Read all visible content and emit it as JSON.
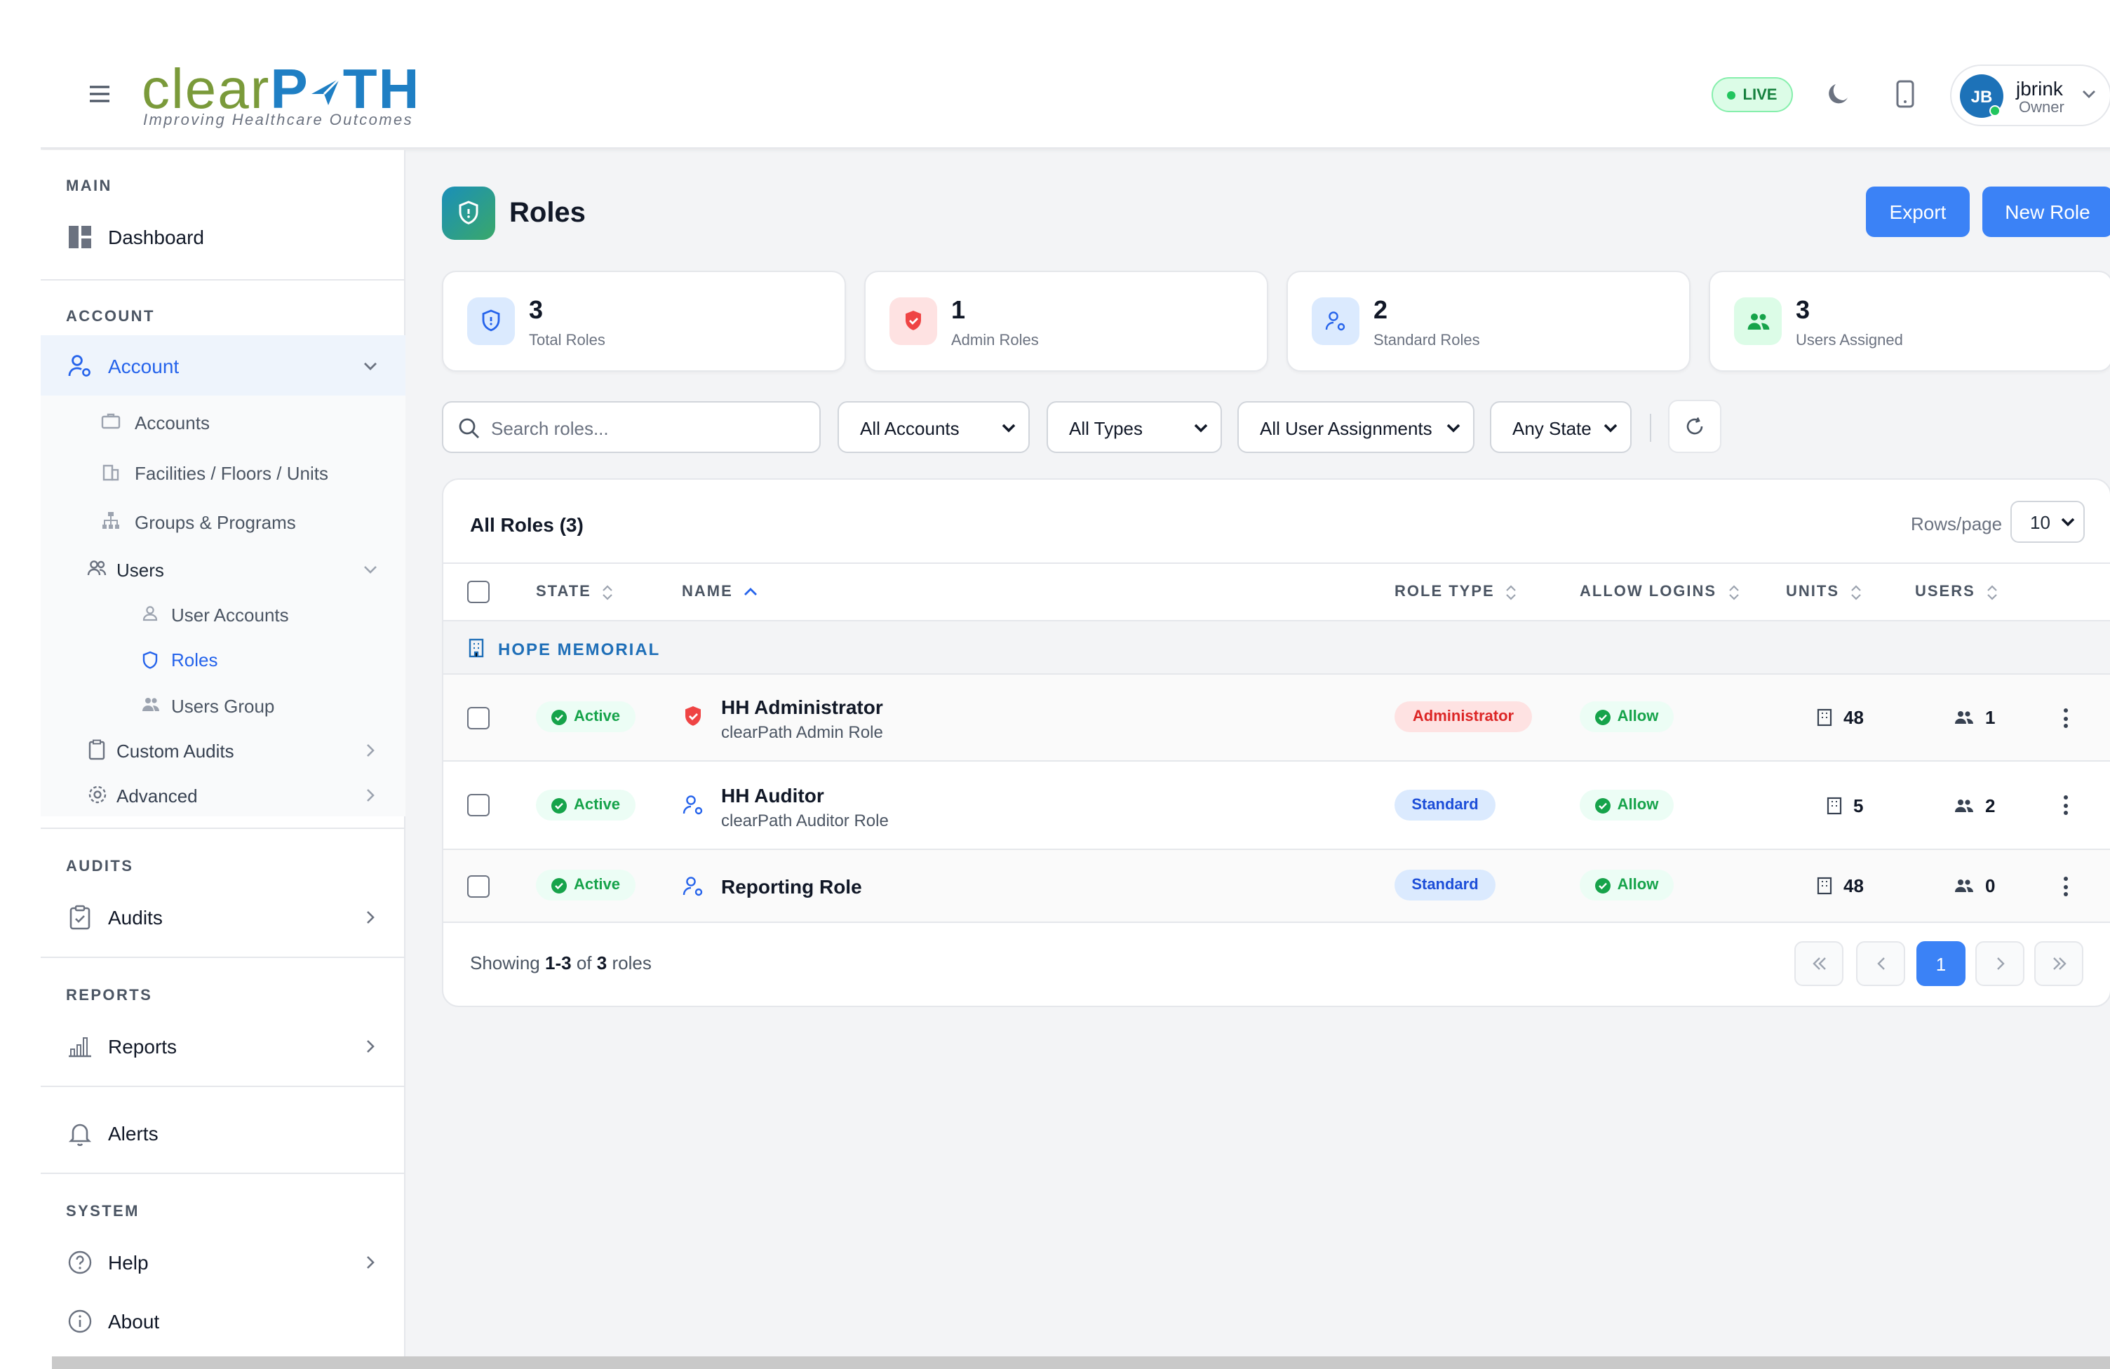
{
  "header": {
    "logo": {
      "clear": "clear",
      "path": "P",
      "path_tail": "TH",
      "tagline": "Improving Healthcare Outcomes"
    },
    "live_label": "LIVE",
    "user": {
      "initials": "JB",
      "name": "jbrink",
      "role": "Owner"
    }
  },
  "sidebar": {
    "main_label": "MAIN",
    "dashboard": "Dashboard",
    "account_section": "ACCOUNT",
    "account": "Account",
    "accounts": "Accounts",
    "facilities": "Facilities / Floors / Units",
    "groups": "Groups & Programs",
    "users": "Users",
    "user_accounts": "User Accounts",
    "roles": "Roles",
    "users_group": "Users Group",
    "custom_audits": "Custom Audits",
    "advanced": "Advanced",
    "audits_section": "AUDITS",
    "audits": "Audits",
    "reports_section": "REPORTS",
    "reports": "Reports",
    "alerts": "Alerts",
    "system_section": "SYSTEM",
    "help": "Help",
    "about": "About"
  },
  "page": {
    "title": "Roles",
    "export_label": "Export",
    "new_role_label": "New Role"
  },
  "stats": [
    {
      "value": "3",
      "label": "Total Roles"
    },
    {
      "value": "1",
      "label": "Admin Roles"
    },
    {
      "value": "2",
      "label": "Standard Roles"
    },
    {
      "value": "3",
      "label": "Users Assigned"
    }
  ],
  "filters": {
    "search_placeholder": "Search roles...",
    "accounts": "All Accounts",
    "types": "All Types",
    "assignments": "All User Assignments",
    "state": "Any State"
  },
  "table": {
    "title": "All Roles (3)",
    "rows_per_page_label": "Rows/page",
    "rows_per_page": "10",
    "columns": {
      "state": "STATE",
      "name": "NAME",
      "role_type": "ROLE TYPE",
      "allow_logins": "ALLOW LOGINS",
      "units": "UNITS",
      "users": "USERS"
    },
    "group": "HOPE MEMORIAL",
    "rows": [
      {
        "state": "Active",
        "name": "HH Administrator",
        "description": "clearPath Admin Role",
        "role_type": "Administrator",
        "allow_logins": "Allow",
        "units": "48",
        "users": "1"
      },
      {
        "state": "Active",
        "name": "HH Auditor",
        "description": "clearPath Auditor Role",
        "role_type": "Standard",
        "allow_logins": "Allow",
        "units": "5",
        "users": "2"
      },
      {
        "state": "Active",
        "name": "Reporting Role",
        "description": "",
        "role_type": "Standard",
        "allow_logins": "Allow",
        "units": "48",
        "users": "0"
      }
    ],
    "footer": {
      "prefix": "Showing",
      "range": "1-3",
      "of": "of",
      "total": "3",
      "suffix": "roles"
    },
    "current_page": "1"
  },
  "colors": {
    "primary": "#3b82f6",
    "brand_green": "#7a9a3a",
    "brand_blue": "#1f7fc4",
    "success": "#16a34a",
    "danger": "#dc2626"
  }
}
